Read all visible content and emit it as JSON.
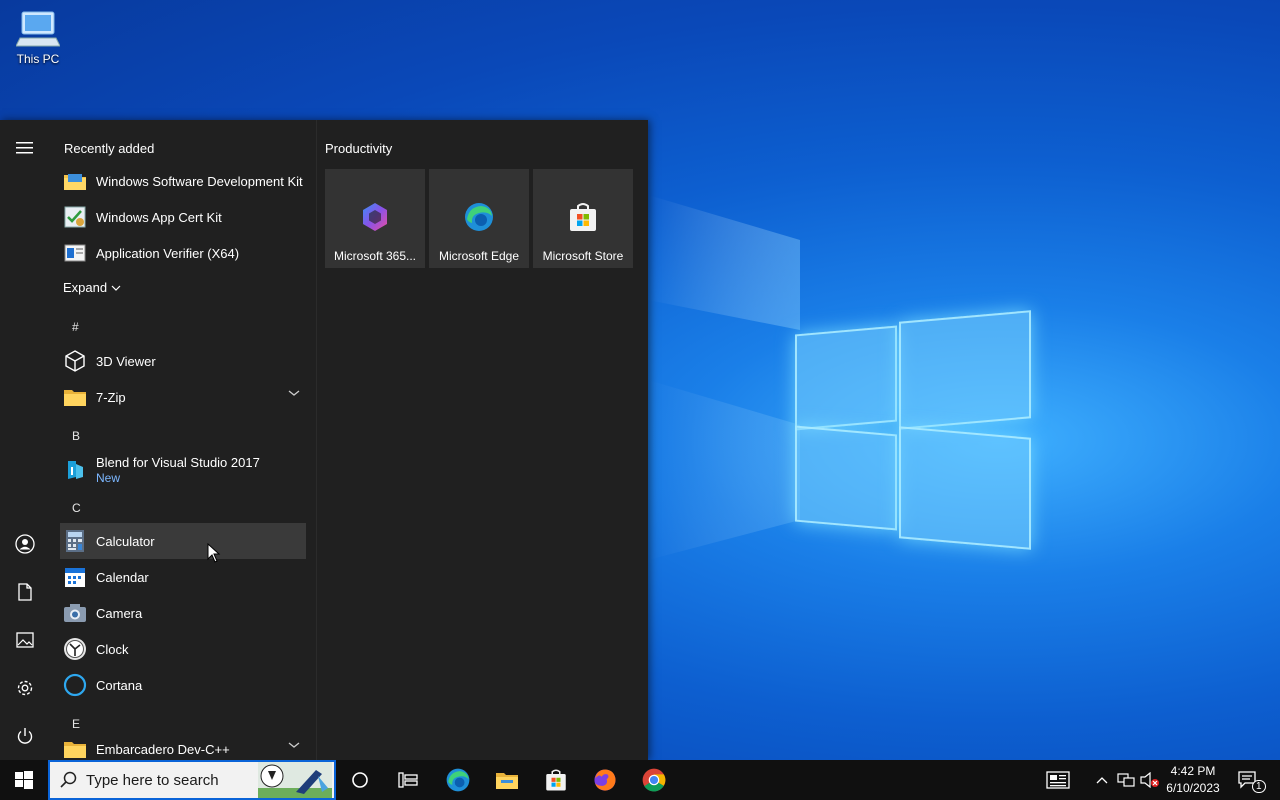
{
  "desktop": {
    "icons": [
      {
        "label": "This PC",
        "icon": "this-pc-icon"
      }
    ]
  },
  "start_menu": {
    "recently_added_label": "Recently added",
    "recent_apps": [
      {
        "label": "Windows Software Development Kit",
        "icon": "folder-icon"
      },
      {
        "label": "Windows App Cert Kit",
        "icon": "cert-kit-icon"
      },
      {
        "label": "Application Verifier (X64)",
        "icon": "app-verifier-icon"
      }
    ],
    "expand_label": "Expand",
    "groups": [
      {
        "letter": "#",
        "apps": [
          {
            "label": "3D Viewer",
            "icon": "3d-viewer-icon"
          },
          {
            "label": "7-Zip",
            "icon": "folder-icon",
            "expandable": true
          }
        ]
      },
      {
        "letter": "B",
        "apps": [
          {
            "label": "Blend for Visual Studio 2017",
            "sublabel": "New",
            "icon": "blend-icon"
          }
        ]
      },
      {
        "letter": "C",
        "apps": [
          {
            "label": "Calculator",
            "icon": "calculator-icon"
          },
          {
            "label": "Calendar",
            "icon": "calendar-icon"
          },
          {
            "label": "Camera",
            "icon": "camera-icon"
          },
          {
            "label": "Clock",
            "icon": "clock-icon"
          },
          {
            "label": "Cortana",
            "icon": "cortana-icon"
          }
        ]
      },
      {
        "letter": "E",
        "apps": [
          {
            "label": "Embarcadero Dev-C++",
            "icon": "folder-icon",
            "expandable": true
          }
        ]
      }
    ],
    "tiles_group_label": "Productivity",
    "tiles": [
      {
        "label": "Microsoft 365...",
        "icon": "m365-icon"
      },
      {
        "label": "Microsoft Edge",
        "icon": "edge-icon"
      },
      {
        "label": "Microsoft Store",
        "icon": "store-icon"
      }
    ],
    "rail": [
      "hamburger-icon",
      "user-icon",
      "documents-icon",
      "pictures-icon",
      "settings-icon",
      "power-icon"
    ]
  },
  "taskbar": {
    "search_placeholder": "Type here to search",
    "time": "4:42 PM",
    "date": "6/10/2023",
    "notification_count": "1"
  },
  "colors": {
    "accent": "#0a64d8",
    "menu_bg": "#202020",
    "tile_bg": "#333333",
    "new_badge": "#7cb7ff"
  }
}
